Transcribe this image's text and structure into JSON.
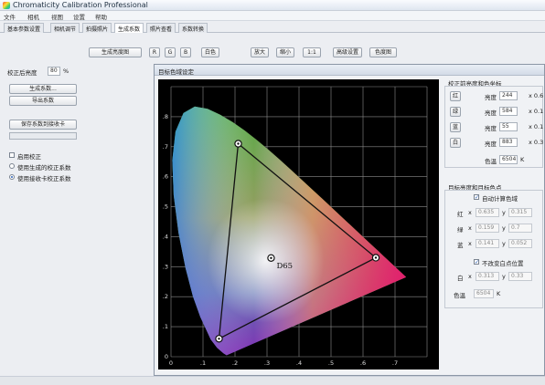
{
  "window": {
    "title": "Chromaticity Calibration Professional"
  },
  "menu": [
    "文件",
    "相机",
    "视图",
    "设置",
    "帮助"
  ],
  "tabs": [
    "基本参数设置",
    "相机调节",
    "拍摄照片",
    "生成系数",
    "照片查看",
    "系数转换"
  ],
  "toolbar": {
    "generate_gamut": "生成亮度图",
    "r": "R",
    "g": "G",
    "b": "B",
    "w": "白色",
    "zoom_in": "放大",
    "zoom_out": "缩小",
    "one_to_one": "1:1",
    "advanced": "高级设置",
    "color_image": "色度图"
  },
  "left": {
    "target_brightness_label": "校正后亮度",
    "target_brightness_value": "80",
    "percent": "%",
    "gen_coeff": "生成系数...",
    "export_coeff": "导出系数",
    "save_to_card": "保存系数到接收卡",
    "enable_label": "启用校正",
    "radio1": "使用生成的校正系数",
    "radio2": "使用接收卡校正系数"
  },
  "dialog": {
    "title": "目标色域设定"
  },
  "right": {
    "section1": "校正前亮度和色坐标",
    "rows": [
      {
        "btn": "红",
        "lab": "亮度",
        "val": "244",
        "xy": "x 0.6"
      },
      {
        "btn": "绿",
        "lab": "亮度",
        "val": "584",
        "xy": "x 0.1"
      },
      {
        "btn": "蓝",
        "lab": "亮度",
        "val": "55",
        "xy": "x 0.1"
      },
      {
        "btn": "白",
        "lab": "亮度",
        "val": "883",
        "xy": "x 0.3"
      }
    ],
    "ct_label": "色温",
    "ct_value": "6504",
    "ct_unit": "K",
    "section2": "目标亮度和目标色点",
    "auto_calc": "自动计算色域",
    "targets": [
      {
        "lab": "红",
        "x": "0.635",
        "y": "0.315"
      },
      {
        "lab": "绿",
        "x": "0.159",
        "y": "0.7"
      },
      {
        "lab": "蓝",
        "x": "0.141",
        "y": "0.052"
      }
    ],
    "no_change_white": "不改变白点位置",
    "white": {
      "lab": "白",
      "x": "0.313",
      "y": "0.33"
    },
    "ct2_label": "色温",
    "ct2_value": "6504",
    "ct2_unit": "K"
  },
  "chart_data": {
    "type": "scatter",
    "title": "",
    "xlim": [
      0,
      0.8
    ],
    "ylim": [
      0,
      0.9
    ],
    "xticks": [
      "0",
      ".1",
      ".2",
      ".3",
      ".4",
      ".5",
      ".6",
      ".7"
    ],
    "yticks": [
      "0",
      ".1",
      ".2",
      ".3",
      ".4",
      ".5",
      ".6",
      ".7",
      ".8"
    ],
    "grid": true,
    "gamut_triangle": [
      [
        0.21,
        0.71
      ],
      [
        0.64,
        0.33
      ],
      [
        0.15,
        0.06
      ]
    ],
    "white_point": {
      "label": "D65",
      "x": 0.3127,
      "y": 0.329
    }
  }
}
